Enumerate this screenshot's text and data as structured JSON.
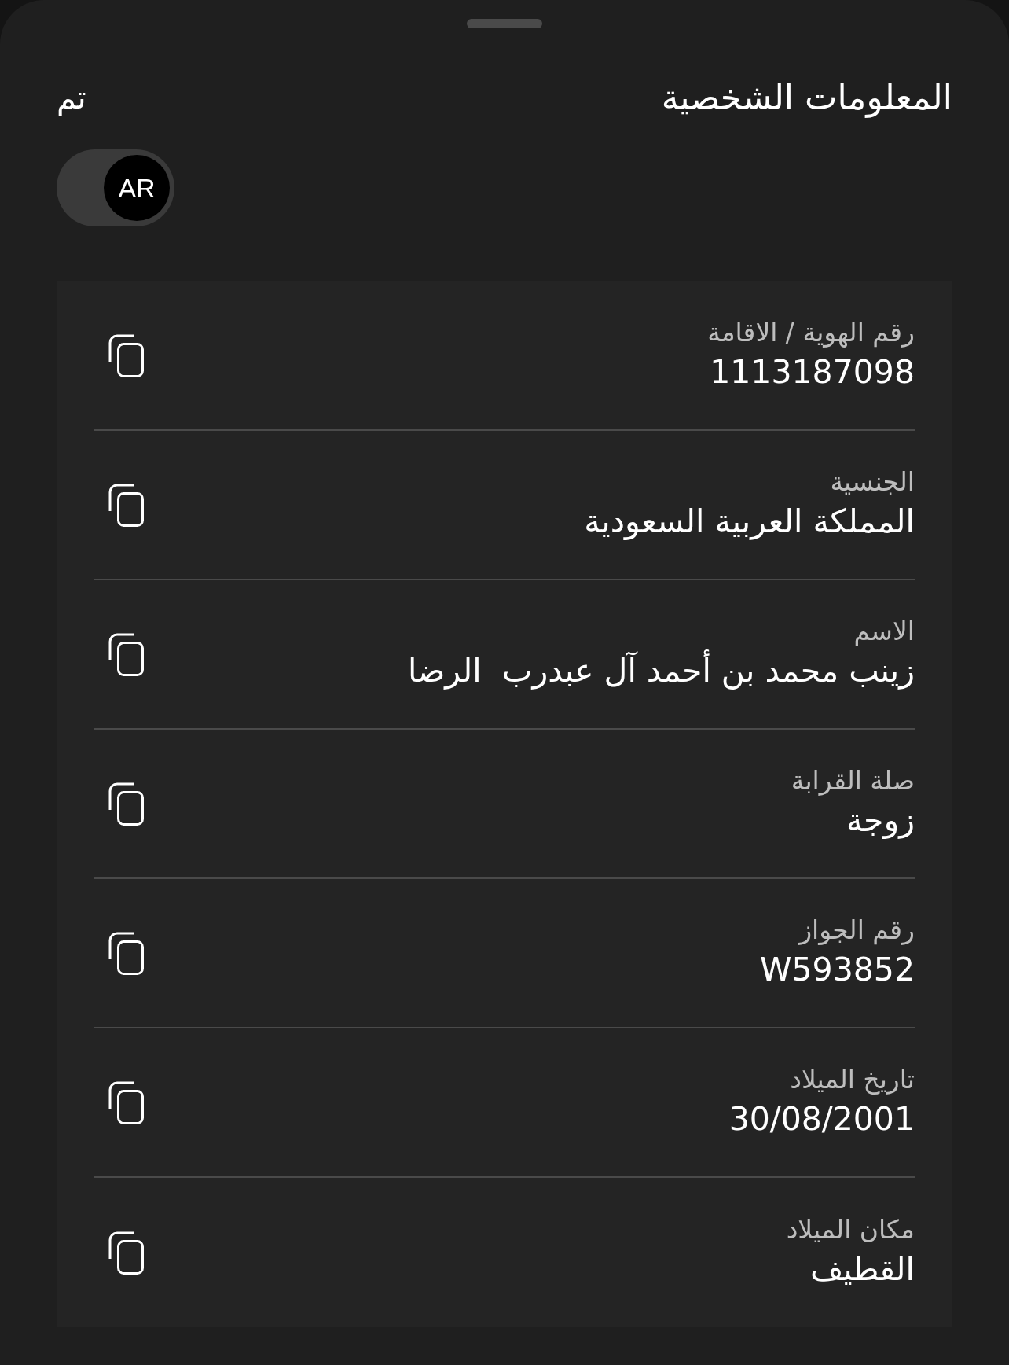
{
  "header": {
    "title": "المعلومات الشخصية",
    "done": "تم"
  },
  "language_toggle": {
    "label": "AR",
    "on": true
  },
  "fields": [
    {
      "label": "رقم الهوية / الاقامة",
      "value": "1113187098"
    },
    {
      "label": "الجنسية",
      "value": "المملكة العربية السعودية"
    },
    {
      "label": "الاسم",
      "value": "زينب محمد بن أحمد آل عبدرب  الرضا"
    },
    {
      "label": "صلة القرابة",
      "value": "زوجة"
    },
    {
      "label": "رقم الجواز",
      "value": "W593852"
    },
    {
      "label": "تاريخ الميلاد",
      "value": "30/08/2001"
    },
    {
      "label": "مكان الميلاد",
      "value": "القطيف"
    }
  ]
}
